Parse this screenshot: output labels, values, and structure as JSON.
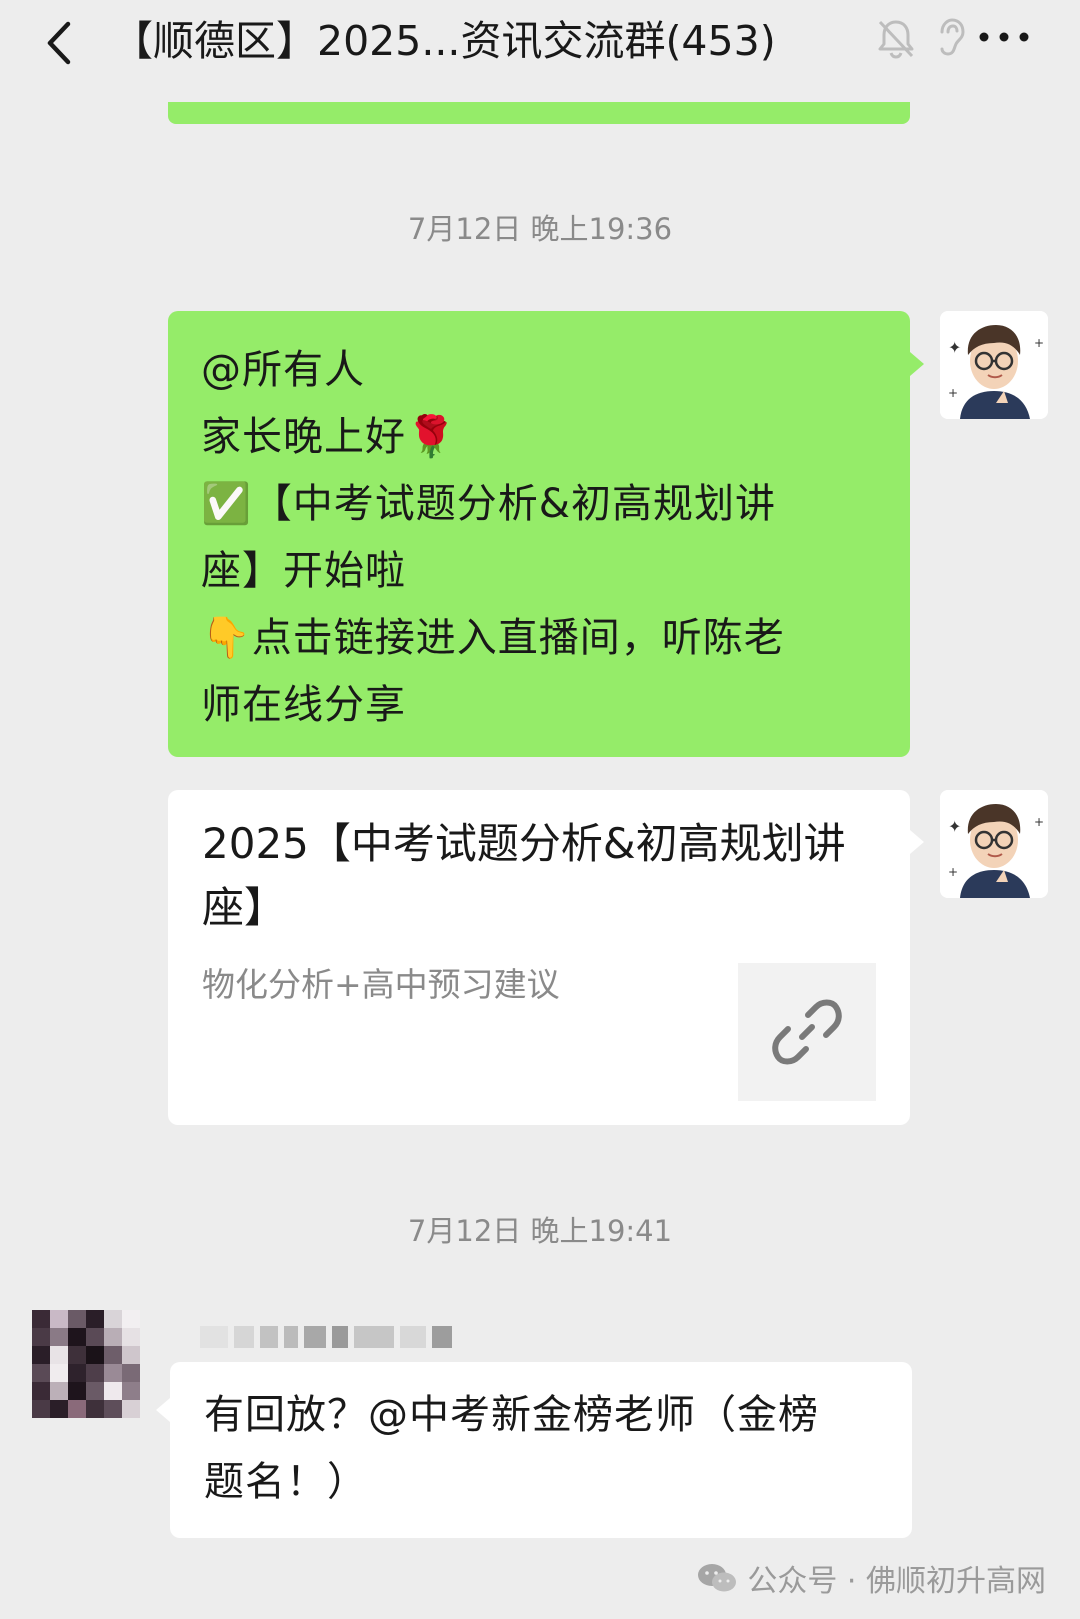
{
  "header": {
    "title": "【顺德区】2025...资讯交流群(453)",
    "icons": [
      "back-icon",
      "mute-bell-icon",
      "ear-icon",
      "more-icon"
    ]
  },
  "messages": [
    {
      "timestamp": "7月12日 晚上19:36",
      "text_lines": [
        "@所有人",
        "家长晚上好🌹",
        "✅【中考试题分析&初高规划讲",
        "座】开始啦",
        "👇点击链接进入直播间，听陈老",
        "师在线分享"
      ],
      "side": "right",
      "color": "#95ec69"
    },
    {
      "card_title_lines": [
        "2025【中考试题分析&初高规划讲",
        "座】"
      ],
      "card_desc": "物化分析+高中预习建议",
      "thumb_icon": "link-icon",
      "side": "right"
    },
    {
      "timestamp": "7月12日 晚上19:41",
      "text_lines": [
        "有回放？@中考新金榜老师（金榜",
        "题名！）"
      ],
      "side": "left"
    }
  ],
  "watermark": {
    "label": "公众号 · 佛顺初升高网",
    "icon": "wechat-icon"
  }
}
